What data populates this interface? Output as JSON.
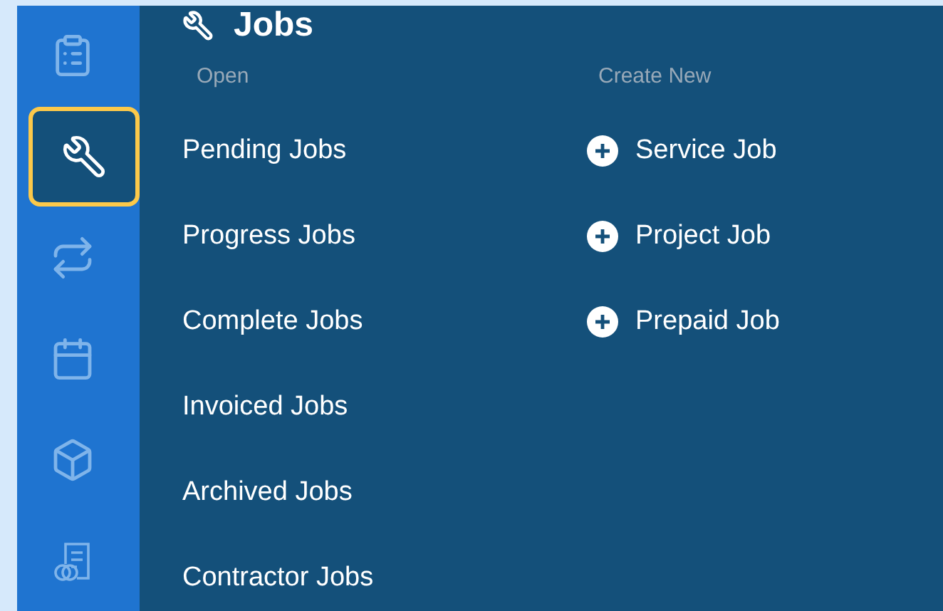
{
  "sidebar": {
    "items": [
      {
        "kind": "clipboard",
        "selected": false
      },
      {
        "kind": "wrench",
        "selected": true
      },
      {
        "kind": "repeat",
        "selected": false
      },
      {
        "kind": "calendar",
        "selected": false
      },
      {
        "kind": "box",
        "selected": false
      },
      {
        "kind": "documents",
        "selected": false
      }
    ]
  },
  "panel": {
    "title": "Jobs",
    "open": {
      "heading": "Open",
      "items": [
        "Pending Jobs",
        "Progress Jobs",
        "Complete Jobs",
        "Invoiced Jobs",
        "Archived Jobs",
        "Contractor Jobs"
      ]
    },
    "create_new": {
      "heading": "Create New",
      "items": [
        "Service Job",
        "Project Job",
        "Prepaid Job"
      ]
    }
  }
}
